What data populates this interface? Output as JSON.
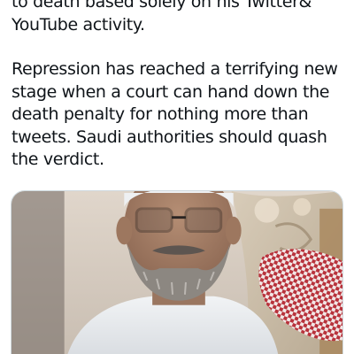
{
  "tweet": {
    "lines": [
      "to death based solely on his Twitter&",
      "YouTube activity.",
      "",
      "Repression has reached a terrifying new",
      "stage when a court can hand down the",
      "death penalty for nothing more than",
      "tweets. Saudi authorities should quash",
      "the verdict."
    ]
  },
  "media": {
    "type": "photo",
    "colors": {
      "background_wall": "#d9cfc4",
      "ornate_chair": "#c9bba7",
      "skin": "#a9826a",
      "beard": "#8c8781",
      "robe": "#e9ebee",
      "red_checkered_cloth": "#b8323b"
    }
  }
}
